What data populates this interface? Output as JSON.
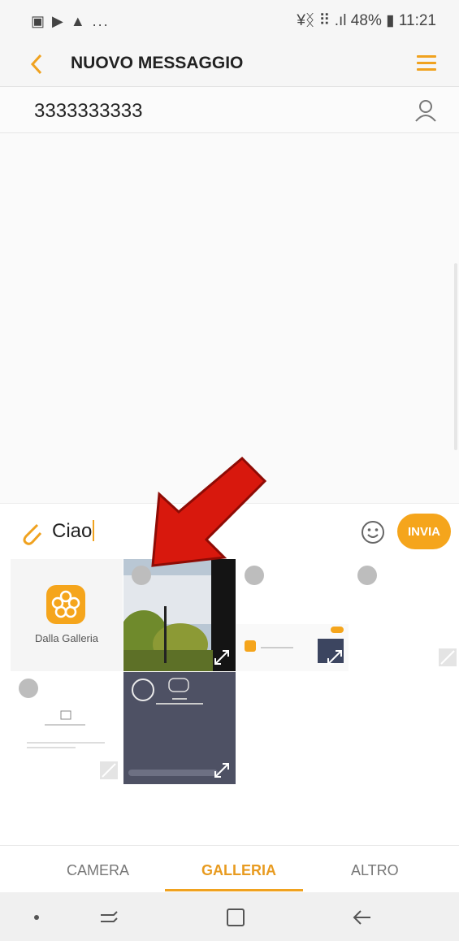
{
  "status_bar": {
    "left_icons": "▣ ▶ ▲ ...",
    "right": "¥ᛝ ⠿ .ıl 48% ▮ 11:21"
  },
  "header": {
    "title": "NUOVO MESSAGGIO",
    "back_icon": "chevron-left-icon",
    "menu_icon": "menu-icon"
  },
  "recipient": {
    "value": "3333333333",
    "contact_icon": "person-icon"
  },
  "composer": {
    "text": "Ciao",
    "send_label": "INVIA",
    "attach_icon": "paperclip-icon",
    "emoji_icon": "smiley-icon"
  },
  "gallery": {
    "from_gallery_label": "Dalla Galleria",
    "thumbnails": 5
  },
  "tabs": [
    {
      "label": "CAMERA",
      "active": false
    },
    {
      "label": "GALLERIA",
      "active": true
    },
    {
      "label": "ALTRO",
      "active": false
    }
  ],
  "accent_color": "#f5a51c"
}
